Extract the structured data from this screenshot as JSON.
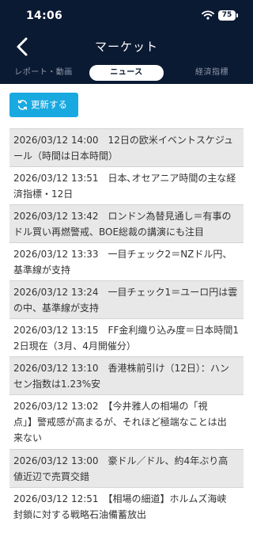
{
  "status": {
    "time": "14:06",
    "battery": "75"
  },
  "header": {
    "title": "マーケット"
  },
  "tabs": [
    "レポート・動画",
    "ニュース",
    "経済指標"
  ],
  "refresh_label": "更新する",
  "news": [
    {
      "line1": "2026/03/12 14:00　12日の欧米イベントスケジュ",
      "line2": "ール（時間は日本時間）"
    },
    {
      "line1": "2026/03/12 13:51　日本､オセアニア時間の主な経",
      "line2": "済指標・12日"
    },
    {
      "line1": "2026/03/12 13:42　ロンドン為替見通し＝有事の",
      "line2": "ドル買い再燃警戒、BOE総裁の講演にも注目"
    },
    {
      "line1": "2026/03/12 13:33　一目チェック2＝NZドル円、",
      "line2": "基準線が支持"
    },
    {
      "line1": "2026/03/12 13:24　一目チェック1＝ユーロ円は雲",
      "line2": "の中、基準線が支持"
    },
    {
      "line1": "2026/03/12 13:15　FF金利織り込み度＝日本時間1",
      "line2": "2日現在（3月、4月開催分）"
    },
    {
      "line1": "2026/03/12 13:10　香港株前引け（12日）：ハン",
      "line2": "セン指数は1.23%安"
    },
    {
      "line1": "2026/03/12 13:02　【今井雅人の相場の「視",
      "line2": "点」】警戒感が高まるが、それほど極端なことは出",
      "line3": "来ない"
    },
    {
      "line1": "2026/03/12 13:00　豪ドル／ドル、約4年ぶり高",
      "line2": "値近辺で売買交錯"
    },
    {
      "line1": "2026/03/12 12:51　【相場の細道】ホルムズ海峡",
      "line2": "封鎖に対する戦略石油備蓄放出"
    }
  ]
}
